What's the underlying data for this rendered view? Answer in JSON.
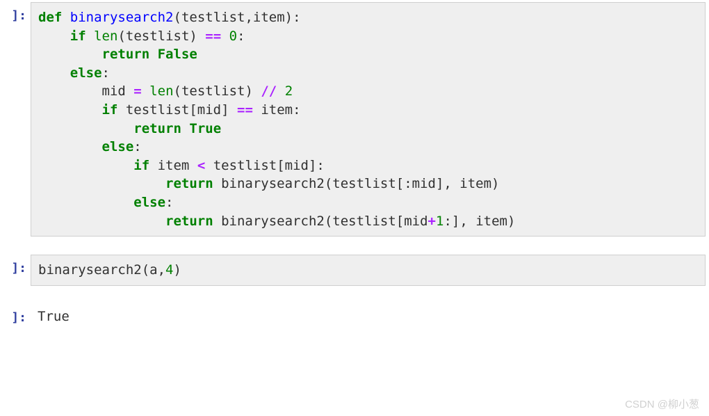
{
  "cells": [
    {
      "prompt": "]:",
      "type": "code",
      "tokens": [
        [
          {
            "t": "def",
            "c": "kw"
          },
          {
            "t": " ",
            "c": "plain"
          },
          {
            "t": "binarysearch2",
            "c": "def"
          },
          {
            "t": "(testlist,item):",
            "c": "plain"
          }
        ],
        [
          {
            "t": "    ",
            "c": "plain"
          },
          {
            "t": "if",
            "c": "kw"
          },
          {
            "t": " ",
            "c": "plain"
          },
          {
            "t": "len",
            "c": "builtin"
          },
          {
            "t": "(testlist) ",
            "c": "plain"
          },
          {
            "t": "==",
            "c": "op"
          },
          {
            "t": " ",
            "c": "plain"
          },
          {
            "t": "0",
            "c": "num"
          },
          {
            "t": ":",
            "c": "plain"
          }
        ],
        [
          {
            "t": "        ",
            "c": "plain"
          },
          {
            "t": "return",
            "c": "kw"
          },
          {
            "t": " ",
            "c": "plain"
          },
          {
            "t": "False",
            "c": "bool"
          }
        ],
        [
          {
            "t": "    ",
            "c": "plain"
          },
          {
            "t": "else",
            "c": "kw"
          },
          {
            "t": ":",
            "c": "plain"
          }
        ],
        [
          {
            "t": "        ",
            "c": "plain"
          },
          {
            "t": "mid ",
            "c": "plain"
          },
          {
            "t": "=",
            "c": "op"
          },
          {
            "t": " ",
            "c": "plain"
          },
          {
            "t": "len",
            "c": "builtin"
          },
          {
            "t": "(testlist) ",
            "c": "plain"
          },
          {
            "t": "//",
            "c": "op"
          },
          {
            "t": " ",
            "c": "plain"
          },
          {
            "t": "2",
            "c": "num"
          }
        ],
        [
          {
            "t": "        ",
            "c": "plain"
          },
          {
            "t": "if",
            "c": "kw"
          },
          {
            "t": " testlist[mid] ",
            "c": "plain"
          },
          {
            "t": "==",
            "c": "op"
          },
          {
            "t": " item:",
            "c": "plain"
          }
        ],
        [
          {
            "t": "            ",
            "c": "plain"
          },
          {
            "t": "return",
            "c": "kw"
          },
          {
            "t": " ",
            "c": "plain"
          },
          {
            "t": "True",
            "c": "bool"
          }
        ],
        [
          {
            "t": "        ",
            "c": "plain"
          },
          {
            "t": "else",
            "c": "kw"
          },
          {
            "t": ":",
            "c": "plain"
          }
        ],
        [
          {
            "t": "            ",
            "c": "plain"
          },
          {
            "t": "if",
            "c": "kw"
          },
          {
            "t": " item ",
            "c": "plain"
          },
          {
            "t": "<",
            "c": "op"
          },
          {
            "t": " testlist[mid]:",
            "c": "plain"
          }
        ],
        [
          {
            "t": "                ",
            "c": "plain"
          },
          {
            "t": "return",
            "c": "kw"
          },
          {
            "t": " binarysearch2(testlist[:mid], item)",
            "c": "plain"
          }
        ],
        [
          {
            "t": "            ",
            "c": "plain"
          },
          {
            "t": "else",
            "c": "kw"
          },
          {
            "t": ":",
            "c": "plain"
          }
        ],
        [
          {
            "t": "                ",
            "c": "plain"
          },
          {
            "t": "return",
            "c": "kw"
          },
          {
            "t": " binarysearch2(testlist[mid",
            "c": "plain"
          },
          {
            "t": "+",
            "c": "op"
          },
          {
            "t": "1",
            "c": "num"
          },
          {
            "t": ":], item)",
            "c": "plain"
          }
        ]
      ]
    },
    {
      "prompt": "]:",
      "type": "code",
      "tokens": [
        [
          {
            "t": "binarysearch2(a,",
            "c": "plain"
          },
          {
            "t": "4",
            "c": "num"
          },
          {
            "t": ")",
            "c": "plain"
          }
        ]
      ]
    },
    {
      "prompt": "]:",
      "type": "output",
      "text": "True"
    }
  ],
  "watermark": "CSDN @柳小葱"
}
